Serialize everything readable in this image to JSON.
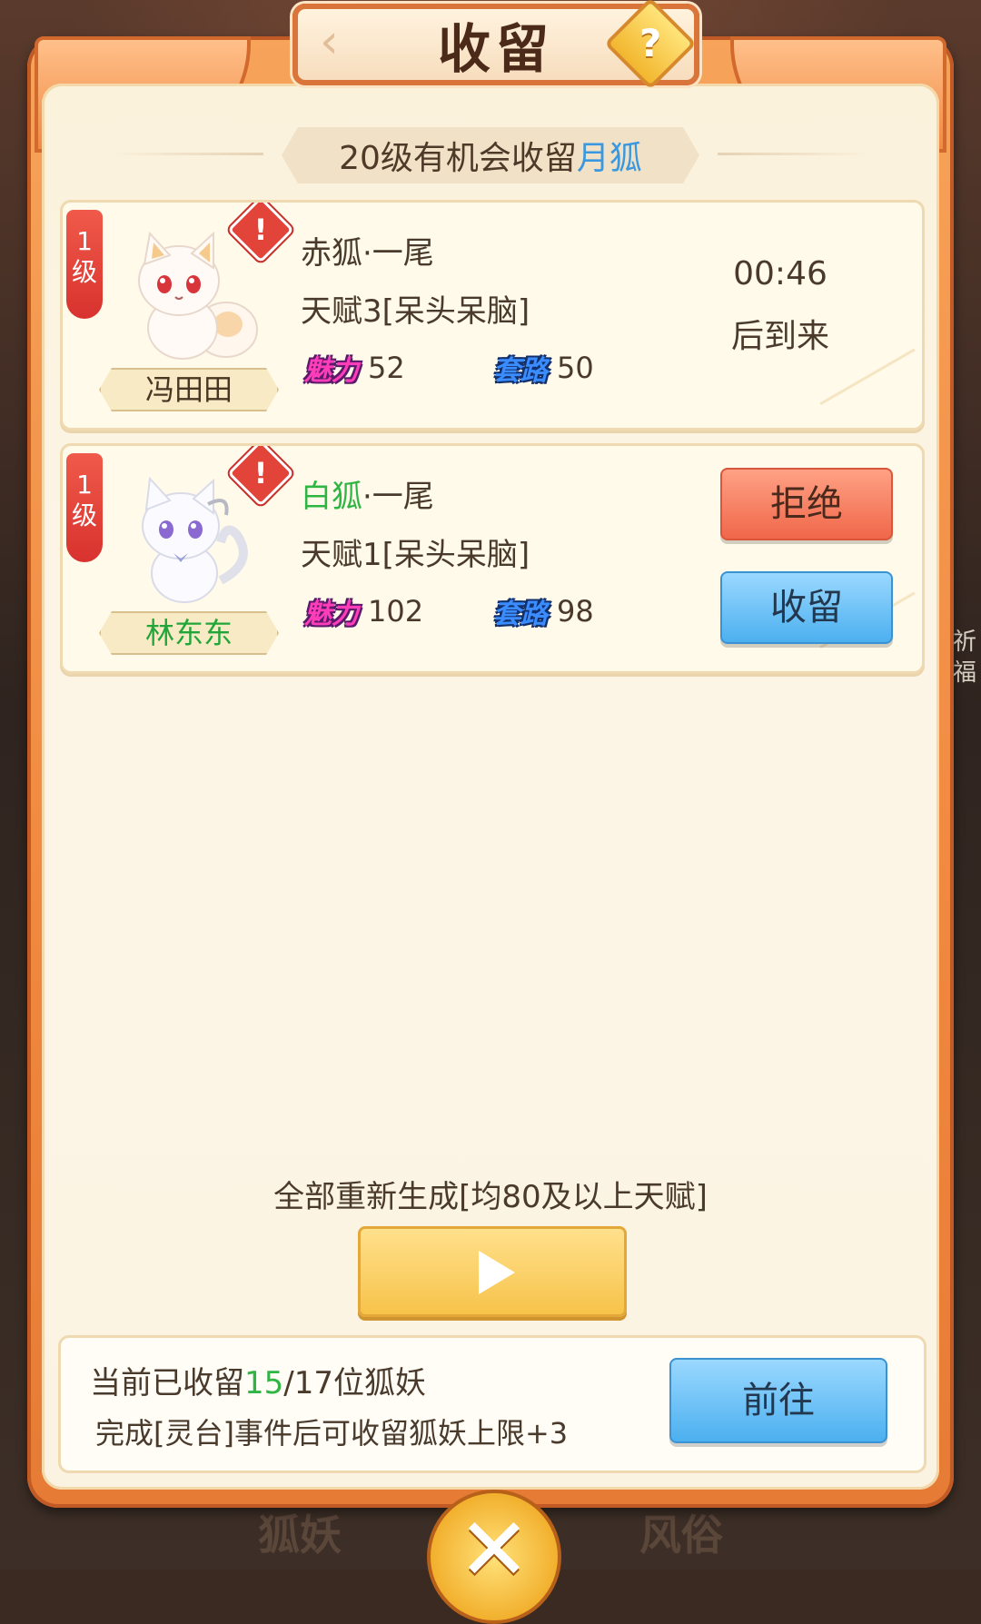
{
  "title": "收留",
  "help_icon": "?",
  "subtitle": {
    "prefix": "20级有机会收留",
    "highlight": "月狐"
  },
  "cards": [
    {
      "level": "1级",
      "owner": "冯田田",
      "fox_type": "赤狐",
      "fox_suffix": "·一尾",
      "talent": "天赋3[呆头呆脑]",
      "charm_label": "魅力",
      "charm": "52",
      "trick_label": "套路",
      "trick": "50",
      "timer": "00:46",
      "timer_suffix": "后到来"
    },
    {
      "level": "1级",
      "owner": "林东东",
      "fox_type": "白狐",
      "fox_suffix": "·一尾",
      "talent": "天赋1[呆头呆脑]",
      "charm_label": "魅力",
      "charm": "102",
      "trick_label": "套路",
      "trick": "98",
      "reject_label": "拒绝",
      "adopt_label": "收留"
    }
  ],
  "regenerate": {
    "text": "全部重新生成[均80及以上天赋]"
  },
  "status": {
    "prefix": "当前已收留",
    "current": "15",
    "suffix": "/17位狐妖",
    "hint": "完成[灵台]事件后可收留狐妖上限+3",
    "goto_label": "前往"
  },
  "background_peek": {
    "right": "祈福",
    "bottom_left": "狐妖",
    "bottom_right": "风俗"
  },
  "colors": {
    "accent_blue": "#3a98e0",
    "accent_green": "#2fb544",
    "frame_orange": "#f1883f"
  }
}
